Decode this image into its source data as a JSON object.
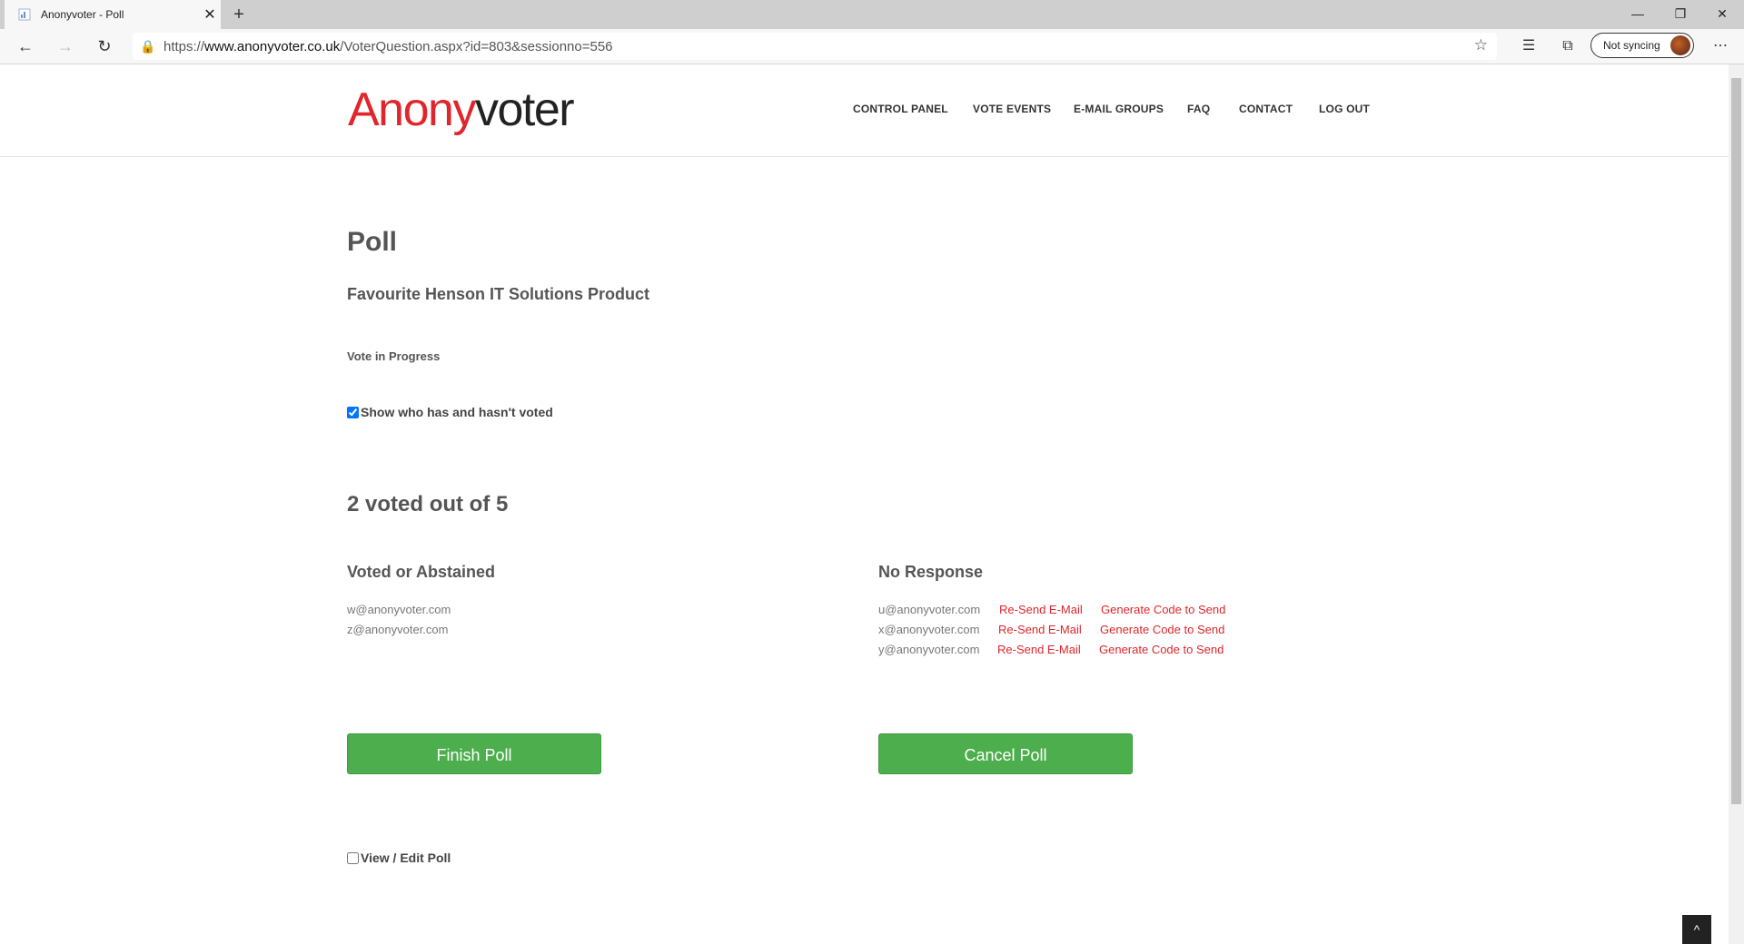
{
  "browser": {
    "tab_title": "Anonyvoter - Poll",
    "tab_close": "✕",
    "new_tab": "+",
    "url_protocol": "https://",
    "url_host": "www.anonyvoter.co.uk",
    "url_path": "/VoterQuestion.aspx?id=803&sessionno=556",
    "sync_label": "Not syncing",
    "window_controls": [
      "—",
      "❐",
      "✕"
    ]
  },
  "header": {
    "logo_part1": "Anony",
    "logo_part2": "voter",
    "nav": [
      "CONTROL PANEL",
      "VOTE EVENTS",
      "E-MAIL GROUPS",
      "FAQ",
      "CONTACT",
      "LOG OUT"
    ]
  },
  "poll": {
    "heading": "Poll",
    "name": "Favourite Henson IT Solutions Product",
    "status": "Vote in Progress",
    "show_voters_label": "Show who has and hasn't voted",
    "show_voters_checked": true,
    "count_text": "2 voted out of 5",
    "voted_heading": "Voted or Abstained",
    "voted": [
      "w@anonyvoter.com",
      "z@anonyvoter.com"
    ],
    "no_response_heading": "No Response",
    "no_response": [
      {
        "email": "u@anonyvoter.com",
        "resend": "Re-Send E-Mail",
        "generate": "Generate Code to Send"
      },
      {
        "email": "x@anonyvoter.com",
        "resend": "Re-Send E-Mail",
        "generate": "Generate Code to Send"
      },
      {
        "email": "y@anonyvoter.com",
        "resend": "Re-Send E-Mail",
        "generate": "Generate Code to Send"
      }
    ],
    "finish_button": "Finish Poll",
    "cancel_button": "Cancel Poll",
    "edit_label": "View / Edit Poll",
    "edit_checked": false
  },
  "colors": {
    "brand_red": "#e0262c",
    "button_green": "#4cae4c",
    "heading_gray": "#555555"
  }
}
